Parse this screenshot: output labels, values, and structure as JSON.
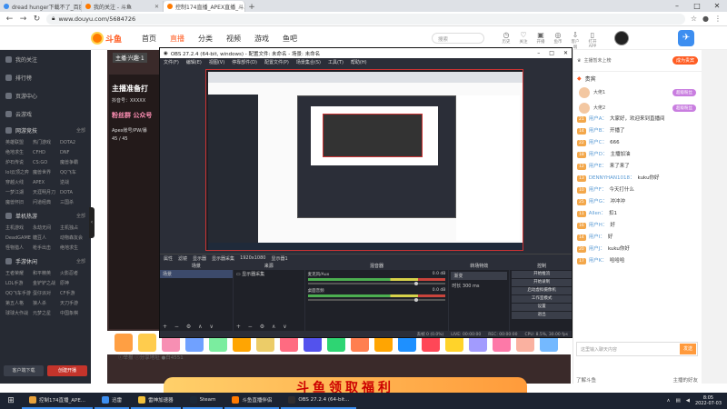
{
  "browser": {
    "tabs": [
      {
        "title": "dread hunger下载不了_百度..."
      },
      {
        "title": "我的关注 - 斗鱼"
      },
      {
        "title": "控制174直播_APEX直播_斗..."
      }
    ],
    "new_tab": "+",
    "url": "www.douyu.com/5684726",
    "window_controls": [
      "–",
      "□",
      "✕"
    ]
  },
  "douyu": {
    "logo": "斗鱼",
    "nav": [
      "首页",
      "直播",
      "分类",
      "视频",
      "游戏",
      "鱼吧"
    ],
    "search_placeholder": "搜索",
    "header_icons": [
      "历史",
      "关注",
      "开播",
      "鱼币",
      "客户端"
    ],
    "header_label_extra": "打开APP"
  },
  "sidebar": {
    "items": [
      "我的关注",
      "排行榜",
      "页游中心",
      "云游戏"
    ],
    "section1": {
      "title": "网游竞技",
      "more": "全部",
      "games": [
        "英雄联盟",
        "热门游戏",
        "DOTA2",
        "绝地求生",
        "CFHD",
        "DNF",
        "炉石传说",
        "CS:GO",
        "魔兽争霸",
        "lol云顶之弈",
        "魔兽世界",
        "QQ飞车",
        "穿越火线",
        "APEX",
        "逆战",
        "一梦江湖",
        "天涯明月刀",
        "DOTA",
        "魔兽怀旧",
        "问道经典",
        "三国杀"
      ]
    },
    "section2": {
      "title": "单机热游",
      "more": "全部",
      "games": [
        "主机游戏",
        "永劫无间",
        "主机独占",
        "DeadGAME",
        "糖豆人",
        "动物森友会",
        "怪物猎人",
        "枪手出击",
        "绝地求生"
      ]
    },
    "section3": {
      "title": "手游休闲",
      "more": "全部",
      "games": [
        "王者荣耀",
        "和平精英",
        "火影忍者",
        "LOL手游",
        "金铲铲之战",
        "原神",
        "QQ飞车手游",
        "蛋仔派对",
        "CF手游",
        "第五人格",
        "狼人杀",
        "天刀手游",
        "球球大作战",
        "元梦之星",
        "中国象棋"
      ]
    },
    "bottom": [
      "客户端下载",
      "创建开播"
    ]
  },
  "stream": {
    "room_tag": "主播·兴趣·1",
    "promo_big": "主播准备打",
    "promo_rows": [
      "抖音号：XXXXX",
      "Apex账号/PW/暴"
    ],
    "promo_pink": "粉丝群  公众号",
    "promo_count": "45 / 45",
    "below_text": "ⓘ举报  ⓘ分享地址  ●白4551"
  },
  "banner": "斗鱼领取福利",
  "obs": {
    "title": "OBS 27.2.4 (64-bit, windows) - 配置文件: 未命名 - 场景: 未命名",
    "menu": [
      "文件(F)",
      "编辑(E)",
      "视图(V)",
      "停靠部件(D)",
      "配置文件(P)",
      "场景集合(S)",
      "工具(T)",
      "帮助(H)"
    ],
    "scene_toolbar": [
      "属性",
      "滤镜",
      "显示器",
      "显示器采集",
      "1920x1080",
      "显示器1"
    ],
    "docks": {
      "scenes": {
        "title": "场景",
        "items": [
          "场景"
        ]
      },
      "sources": {
        "title": "来源",
        "items": [
          "显示器采集"
        ]
      },
      "mixer": {
        "title": "混音器",
        "channels": [
          {
            "name": "麦克风/Aux",
            "db": "0.0 dB"
          },
          {
            "name": "桌面音频",
            "db": "0.0 dB"
          }
        ]
      },
      "transitions": {
        "title": "转场特效",
        "type": "渐变",
        "duration_label": "时长",
        "duration": "300 ms"
      },
      "controls": {
        "title": "控制",
        "buttons": [
          "开始推流",
          "开始录制",
          "启动虚拟摄像机",
          "工作室模式",
          "设置",
          "退出"
        ]
      }
    },
    "dock_footer": "+ − ⚙ ∧ ∨",
    "status": [
      "丢帧 0 (0.0%)",
      "LIVE: 00:00:00",
      "REC: 00:00:00",
      "CPU: 8.5%, 30.00 fps"
    ]
  },
  "chat": {
    "top_text": "主播暂未上榜",
    "top_button": "成为贵宾",
    "rank_title": "贵宾",
    "ranks": [
      {
        "name": "大佬1",
        "badge": "超级粉丝"
      },
      {
        "name": "大佬2",
        "badge": "超级粉丝"
      }
    ],
    "messages": [
      {
        "lv": "21",
        "name": "用户A：",
        "text": "大家好，欢迎来到直播间"
      },
      {
        "lv": "14",
        "name": "用户B：",
        "text": "开播了"
      },
      {
        "lv": "22",
        "name": "用户C：",
        "text": "666"
      },
      {
        "lv": "18",
        "name": "用户D：",
        "text": "主播加油"
      },
      {
        "lv": "12",
        "name": "用户E：",
        "text": "来了来了"
      },
      {
        "lv": "13",
        "name": "DENNYHAN1018：",
        "text": "kuku你好"
      },
      {
        "lv": "10",
        "name": "用户F：",
        "text": "今天打什么"
      },
      {
        "lv": "25",
        "name": "用户G：",
        "text": "冲冲冲"
      },
      {
        "lv": "11",
        "name": "Allen：",
        "text": "扣1"
      },
      {
        "lv": "16",
        "name": "用户H：",
        "text": "好"
      },
      {
        "lv": "14",
        "name": "用户I：",
        "text": "好"
      },
      {
        "lv": "20",
        "name": "用户J：",
        "text": "kuku你好"
      },
      {
        "lv": "17",
        "name": "用户K：",
        "text": "哈哈哈"
      }
    ],
    "input_placeholder": "这里输入聊天内容",
    "send": "发送",
    "footer_left": "了解斗鱼",
    "footer_right": "主播的好友"
  },
  "taskbar": {
    "start": "⊞",
    "apps": [
      {
        "label": "控制174直播_APE...",
        "color": "#e9a23b"
      },
      {
        "label": "迅雷",
        "color": "#3c8ef0"
      },
      {
        "label": "雷神加速器",
        "color": "#f3c13a"
      },
      {
        "label": "Steam",
        "color": "#1b2838"
      },
      {
        "label": "斗鱼直播伴侣",
        "color": "#ff7a00"
      },
      {
        "label": "OBS 27.2.4 (64-bit...",
        "color": "#302e31"
      }
    ],
    "time": "8:05",
    "date": "2022-07-03"
  }
}
